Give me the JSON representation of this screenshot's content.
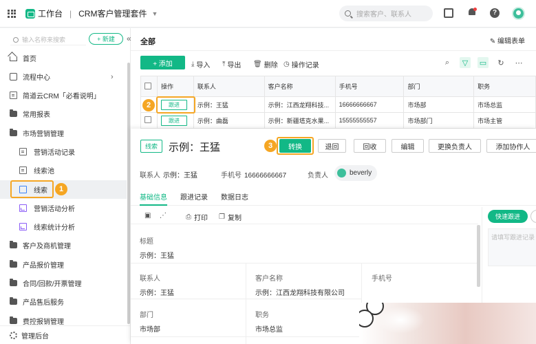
{
  "topbar": {
    "workspace": "工作台",
    "separator": "|",
    "app_title": "CRM客户管理套件",
    "search_placeholder": "搜索客户、联系人"
  },
  "sidebar": {
    "search_placeholder": "输入名称来搜索",
    "new_label": "+ 新建",
    "collapse_glyph": "«",
    "items": [
      {
        "label": "首页",
        "icon": "home-icon"
      },
      {
        "label": "流程中心",
        "icon": "flow-icon"
      },
      {
        "label": "简道云CRM「必看说明」",
        "icon": "doc-icon"
      },
      {
        "label": "常用报表",
        "icon": "folder-icon"
      },
      {
        "label": "市场营销管理",
        "icon": "folder-icon"
      },
      {
        "label": "营销活动记录",
        "icon": "doc-icon"
      },
      {
        "label": "线索池",
        "icon": "doc-icon"
      },
      {
        "label": "线索",
        "icon": "map-icon"
      },
      {
        "label": "营销活动分析",
        "icon": "chart-icon"
      },
      {
        "label": "线索统计分析",
        "icon": "chart-icon"
      },
      {
        "label": "客户及商机管理",
        "icon": "folder-icon"
      },
      {
        "label": "产品报价管理",
        "icon": "folder-icon"
      },
      {
        "label": "合同/回款/开票管理",
        "icon": "folder-icon"
      },
      {
        "label": "产品售后服务",
        "icon": "folder-icon"
      },
      {
        "label": "费控报销管理",
        "icon": "folder-icon"
      }
    ],
    "admin_label": "管理后台",
    "step_badge": "1"
  },
  "main": {
    "title": "全部",
    "edit_form": "✎ 编辑表单",
    "toolbar": {
      "add": "+ 添加",
      "import": "导入",
      "export": "导出",
      "delete": "删除",
      "history": "操作记录"
    },
    "table": {
      "headers": [
        "操作",
        "联系人",
        "客户名称",
        "手机号",
        "部门",
        "职务"
      ],
      "rows": [
        {
          "action": "跟进",
          "contact": "示例：王猛",
          "customer": "示例：江西龙翔科技...",
          "phone": "16666666667",
          "dept": "市场部",
          "title": "市场总监"
        },
        {
          "action": "跟进",
          "contact": "示例：曲磊",
          "customer": "示例：新疆塔克水果...",
          "phone": "15555555557",
          "dept": "市场部门",
          "title": "市场主管"
        }
      ]
    },
    "step_badge": "2"
  },
  "detail": {
    "tag": "线索",
    "title": "示例：王猛",
    "step_badge": "3",
    "buttons": [
      "转换",
      "退回",
      "回收",
      "编辑",
      "更换负责人",
      "添加协作人"
    ],
    "contact_label": "联系人",
    "contact_value": "示例：王猛",
    "phone_label": "手机号",
    "phone_value": "16666666667",
    "owner_label": "负责人",
    "owner_value": "beverly",
    "tabs": [
      "基础信息",
      "跟进记录",
      "数据日志"
    ],
    "subbar": {
      "print": "打印",
      "copy": "复制"
    },
    "fields": {
      "title_label": "标题",
      "title_value": "示例：王猛",
      "contact_label": "联系人",
      "contact_value": "示例：王猛",
      "customer_label": "客户名称",
      "customer_value": "示例：江西龙翔科技有限公司",
      "phone_label": "手机号",
      "dept_label": "部门",
      "dept_value": "市场部",
      "job_label": "职务",
      "job_value": "市场总监"
    },
    "quick_follow": "快速跟进",
    "quick_placeholder": "请填写跟进记录"
  },
  "colors": {
    "accent": "#12b886",
    "highlight": "#f5a623"
  }
}
